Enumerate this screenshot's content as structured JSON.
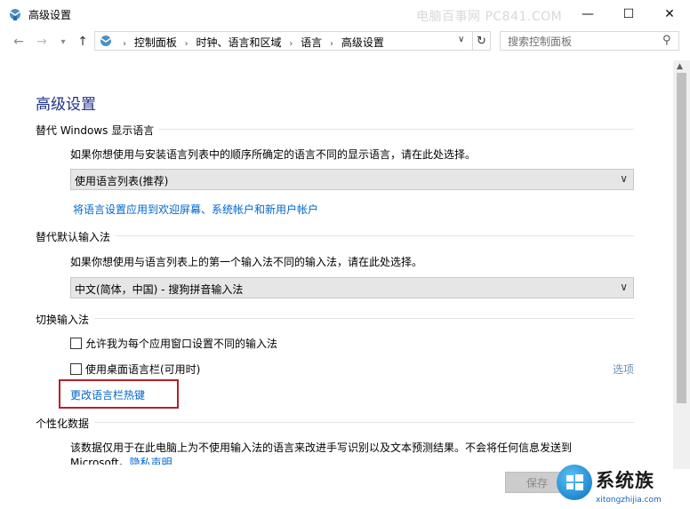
{
  "window": {
    "title": "高级设置",
    "watermark": "电脑百事网 PC841.COM",
    "controls": {
      "minimize": "—",
      "maximize": "☐",
      "close": "✕"
    }
  },
  "nav": {
    "back_icon": "←",
    "forward_icon": "→",
    "history_icon": "▾",
    "up_icon": "↑",
    "breadcrumbs": [
      "控制面板",
      "时钟、语言和区域",
      "语言",
      "高级设置"
    ],
    "breadcrumb_sep": "›",
    "dropdown_icon": "∨",
    "refresh_icon": "↻",
    "search_placeholder": "搜索控制面板",
    "search_icon": "⚲"
  },
  "page_title": "高级设置",
  "sections": {
    "display_language": {
      "title": "替代 Windows 显示语言",
      "description": "如果你想使用与安装语言列表中的顺序所确定的语言不同的显示语言，请在此处选择。",
      "select_value": "使用语言列表(推荐)",
      "link": "将语言设置应用到欢迎屏幕、系统帐户和新用户帐户"
    },
    "default_input": {
      "title": "替代默认输入法",
      "description": "如果你想使用与语言列表上的第一个输入法不同的输入法，请在此处选择。",
      "select_value": "中文(简体，中国) - 搜狗拼音输入法"
    },
    "switch_input": {
      "title": "切换输入法",
      "checkbox_per_app": "允许我为每个应用窗口设置不同的输入法",
      "checkbox_desktop_bar": "使用桌面语言栏(可用时)",
      "options_link": "选项",
      "hotkey_link": "更改语言栏热键"
    },
    "personalization": {
      "title": "个性化数据",
      "description": "该数据仅用于在此电脑上为不使用输入法的语言来改进手写识别以及文本预测结果。不会将任何信息发送到",
      "description_cont": "Microsoft。",
      "privacy_link": "隐私声明"
    }
  },
  "footer": {
    "save_label": "保存",
    "logo_text": "系统族",
    "logo_url": "xitongzhijia.com"
  },
  "colors": {
    "title_blue": "#1e3287",
    "link_blue": "#0066cc",
    "highlight_red": "#b3222c"
  }
}
